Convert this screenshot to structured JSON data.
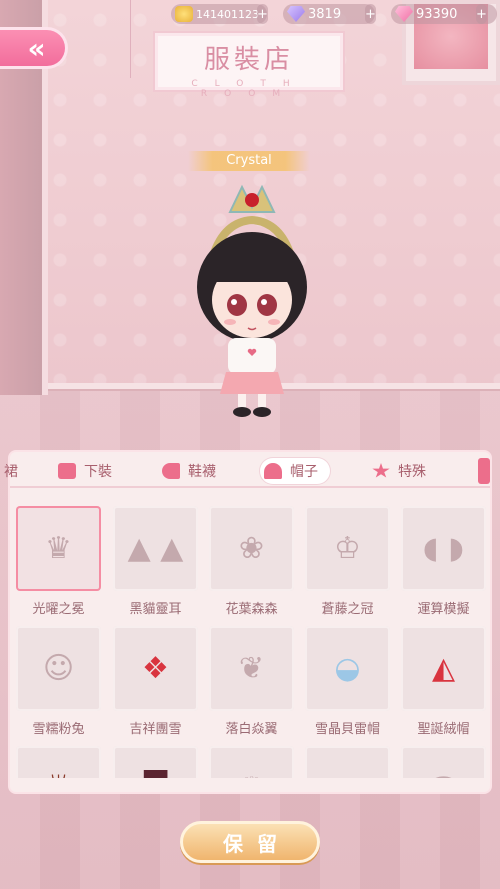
{
  "top_bar": {
    "coins": "141401123",
    "gems": "3819",
    "pink_gems": "93390",
    "plus_label": "+"
  },
  "back_label": "«",
  "shop": {
    "title": "服裝店",
    "subtitle": "CLOTH  ROOM"
  },
  "character": {
    "name": "Crystal"
  },
  "tabs": [
    {
      "label": "裙",
      "icon": "dress-icon"
    },
    {
      "label": "下裝",
      "icon": "pants-icon"
    },
    {
      "label": "鞋襪",
      "icon": "shoe-icon"
    },
    {
      "label": "帽子",
      "icon": "hat-icon",
      "active": true
    },
    {
      "label": "特殊",
      "icon": "star-icon"
    }
  ],
  "items": [
    {
      "label": "光曜之冕",
      "icon": "crown-icon",
      "selected": true
    },
    {
      "label": "黑貓靈耳",
      "icon": "cat-ears-icon"
    },
    {
      "label": "花葉森森",
      "icon": "flower-wreath-icon"
    },
    {
      "label": "蒼藤之冠",
      "icon": "vine-crown-icon"
    },
    {
      "label": "運算模擬",
      "icon": "headphones-icon"
    },
    {
      "label": "雪糯粉兔",
      "icon": "bunny-hood-icon"
    },
    {
      "label": "吉祥團雪",
      "icon": "knot-ornament-icon"
    },
    {
      "label": "落白焱翼",
      "icon": "wings-icon"
    },
    {
      "label": "雪晶貝雷帽",
      "icon": "beret-icon"
    },
    {
      "label": "聖誕絨帽",
      "icon": "santa-hat-icon"
    },
    {
      "label": "",
      "icon": "antlers-icon"
    },
    {
      "label": "",
      "icon": "top-hat-icon"
    },
    {
      "label": "",
      "icon": "tiara-icon"
    },
    {
      "label": "",
      "icon": "bow-hat-icon"
    },
    {
      "label": "",
      "icon": "veil-icon"
    }
  ],
  "keep_button": "保留"
}
